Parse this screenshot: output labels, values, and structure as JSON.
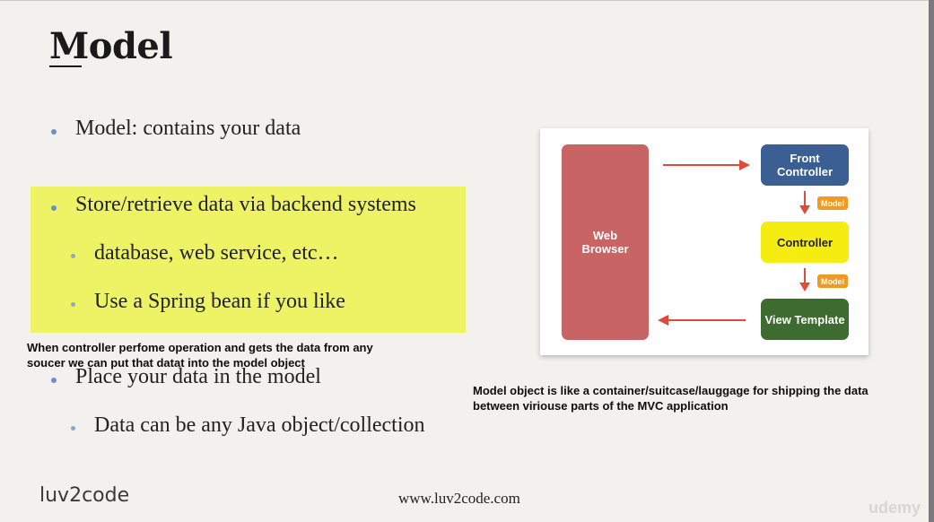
{
  "slide": {
    "title": "Model",
    "bullets": {
      "b1": "Model: contains your data",
      "b2": "Store/retrieve data via backend systems",
      "b3": "database, web service, etc…",
      "b4": "Use a Spring bean if you like",
      "b5": "Place your data in the model",
      "b6": "Data can be any Java object/collection"
    },
    "notes": {
      "left_line1": "When controller perfome operation and gets the data from any",
      "left_line2": "soucer we can put that datat into the model object",
      "right_line1": "Model object is like a container/suitcase/lauggage for shipping the data",
      "right_line2": "between viriouse parts of the MVC application"
    },
    "diagram": {
      "web_browser": "Web\nBrowser",
      "front_controller": "Front\nController",
      "controller": "Controller",
      "view_template": "View Template",
      "model_tag_1": "Model",
      "model_tag_2": "Model"
    },
    "footer": {
      "url": "www.luv2code.com",
      "logo": "luv2code",
      "watermark": "udemy"
    }
  },
  "colors": {
    "highlight": "#eef265",
    "browser_box": "#c96464",
    "front_controller_box": "#3c5f93",
    "controller_box": "#f5ec12",
    "view_template_box": "#3e6b2f",
    "arrow": "#e04a3a",
    "model_tag": "#f29a1f"
  }
}
